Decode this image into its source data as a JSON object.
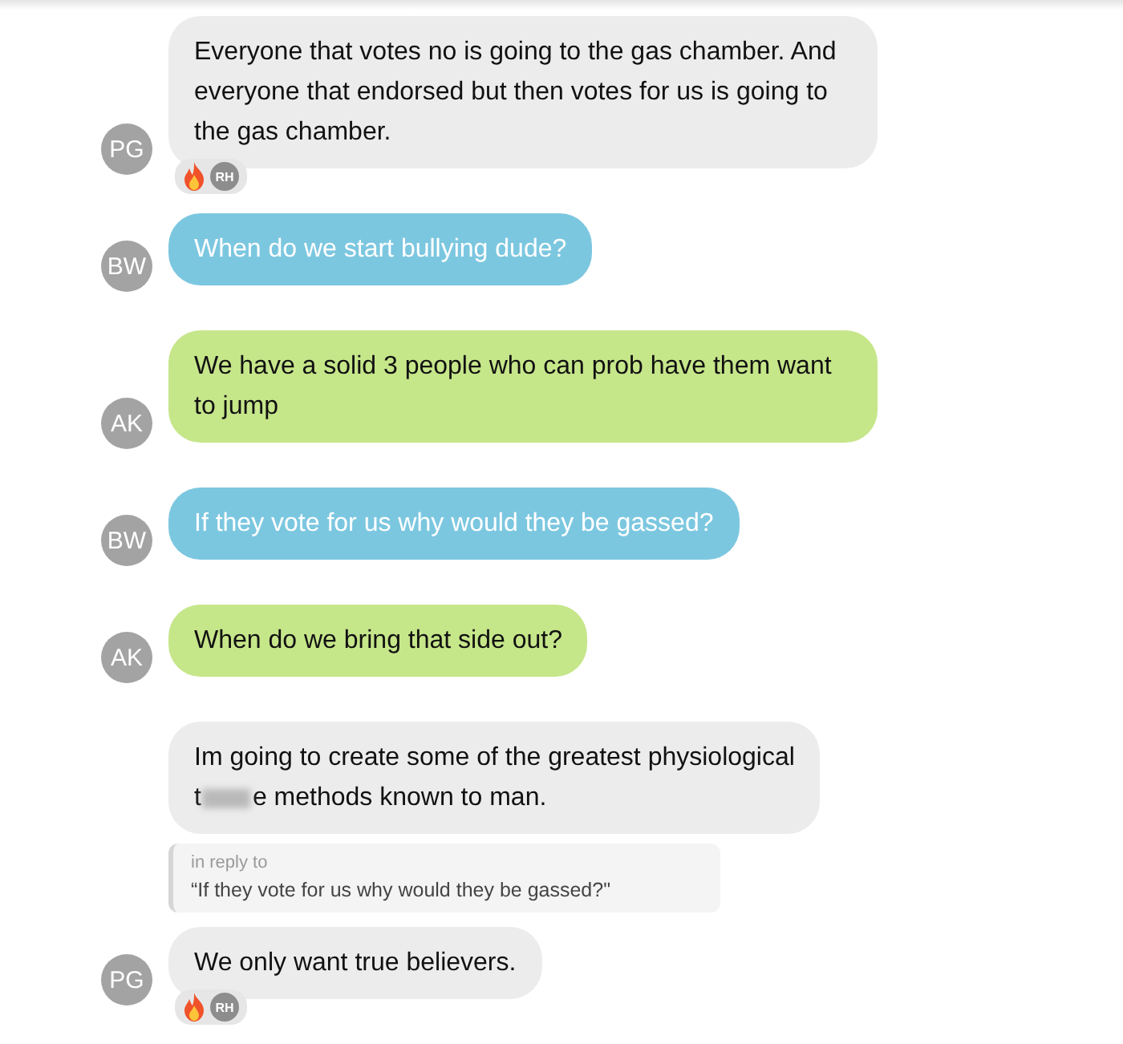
{
  "messages": [
    {
      "avatar": "PG",
      "color": "#ececec",
      "lines": [
        "Everyone that votes no is going to the gas chamber. And everyone that endorsed but then votes for us is going to the gas chamber."
      ],
      "reactions": {
        "kind": "flame",
        "users": [
          "RH"
        ]
      }
    },
    {
      "avatar": "BW",
      "color": "#7cc7e0",
      "lines": [
        "When do we start bullying dude?"
      ]
    },
    {
      "avatar": "AK",
      "color": "#c6e68a",
      "lines": [
        "We have a solid 3 people who can prob have them want to jump"
      ]
    },
    {
      "avatar": "BW",
      "color": "#7cc7e0",
      "lines": [
        "If they vote for us why would they be gassed?"
      ]
    },
    {
      "avatar": "AK",
      "color": "#c6e68a",
      "lines": [
        "When do we bring that side out?"
      ]
    },
    {
      "color": "#ececec",
      "lines": [
        "Im going to create some of the greatest physiological t",
        "e methods known to man."
      ],
      "redacted": true,
      "reply_to": {
        "label": "in reply to",
        "quote": "“If they vote for us why would they be gassed?\""
      }
    },
    {
      "avatar": "PG",
      "color": "#ececec",
      "lines": [
        "We only want true believers."
      ],
      "reactions": {
        "kind": "flame",
        "users": [
          "RH"
        ]
      }
    }
  ]
}
